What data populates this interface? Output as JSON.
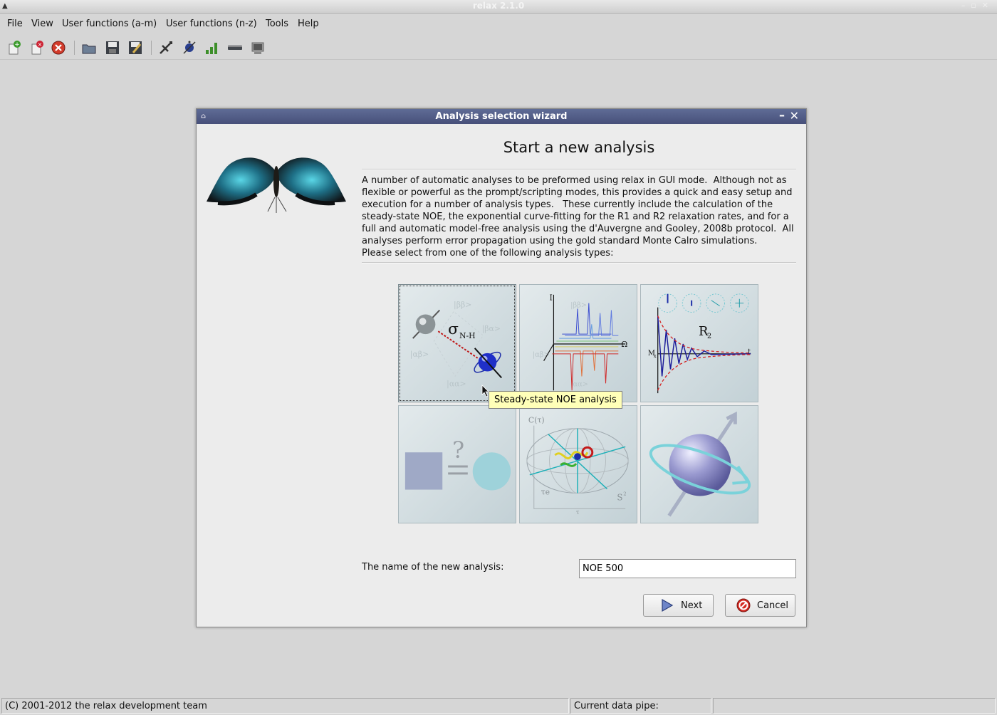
{
  "window": {
    "title": "relax 2.1.0"
  },
  "menu": [
    "File",
    "View",
    "User functions (a-m)",
    "User functions (n-z)",
    "Tools",
    "Help"
  ],
  "toolbar": {
    "icons": [
      "new-analysis-icon",
      "close-analysis-icon",
      "close-all-icon",
      "open-icon",
      "save-icon",
      "save-as-icon",
      "spin-viewer-icon",
      "molecule-icon",
      "results-icon",
      "pipe-editor-icon",
      "prompt-icon"
    ]
  },
  "dialog": {
    "title": "Analysis selection wizard",
    "heading": "Start a new analysis",
    "description": "A number of automatic analyses to be preformed using relax in GUI mode.  Although not as flexible or powerful as the prompt/scripting modes, this provides a quick and easy setup and execution for a number of analysis types.   These currently include the calculation of the steady-state NOE, the exponential curve-fitting for the R1 and R2 relaxation rates, and for a full and automatic model-free analysis using the d'Auvergne and Gooley, 2008b protocol.  All analyses perform error propagation using the gold standard Monte Calro simulations.\nPlease select from one of the following analysis types:",
    "tiles": {
      "noe": {
        "sigma": "σ",
        "sub": "N-H",
        "kets": [
          "|ββ>",
          "|βα>",
          "|αβ>",
          "|αα>"
        ]
      },
      "r1": {
        "i_label": "I",
        "omega": "Ω",
        "kets": [
          "|ββ>",
          "|αβ>",
          "|αα>"
        ]
      },
      "r2": {
        "r2": "R",
        "r2_sub": "2",
        "m": "M",
        "m_sub": "x",
        "t": "t"
      },
      "custom": {
        "q": "?"
      },
      "mf": {
        "c": "C(τ)",
        "te": "τe",
        "s2": "S",
        "s2_sup": "2",
        "tau": "τ"
      }
    },
    "tooltip": "Steady-state NOE analysis",
    "name_label": "The name of the new analysis:",
    "name_value": "NOE 500",
    "next_label": "Next",
    "cancel_label": "Cancel"
  },
  "status": {
    "copyright": "(C) 2001-2012 the relax development team",
    "pipe_label": "Current data pipe:"
  }
}
